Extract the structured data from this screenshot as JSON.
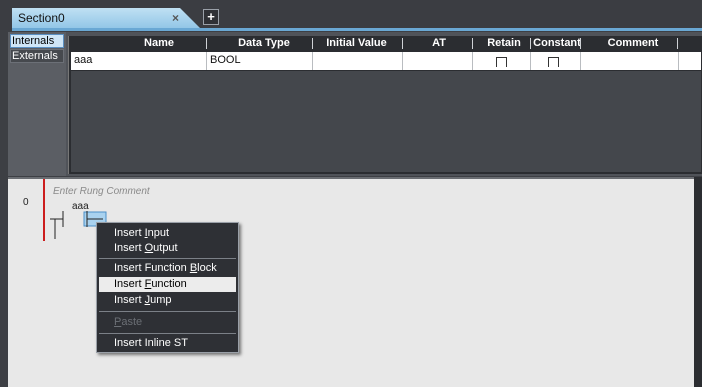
{
  "tab": {
    "title": "Section0",
    "close": "×",
    "add": "+"
  },
  "var_tabs": {
    "internals": "Internals",
    "externals": "Externals"
  },
  "table": {
    "headers": [
      "Name",
      "Data Type",
      "Initial Value",
      "AT",
      "Retain",
      "Constant",
      "Comment"
    ],
    "rows": [
      {
        "name": "aaa",
        "data_type": "BOOL",
        "initial_value": "",
        "at": "",
        "retain": false,
        "constant": false,
        "comment": ""
      }
    ]
  },
  "ladder": {
    "rung_number": "0",
    "rung_comment_placeholder": "Enter Rung Comment",
    "contact_variable": "aaa",
    "rail_color": "#cc1d1d"
  },
  "context_menu": {
    "items": [
      {
        "label": "Insert Input",
        "accel": "I",
        "state": "normal"
      },
      {
        "label": "Insert Output",
        "accel": "O",
        "state": "normal"
      },
      {
        "label": "Insert Function Block",
        "accel": "B",
        "state": "normal"
      },
      {
        "label": "Insert Function",
        "accel": "F",
        "state": "highlighted"
      },
      {
        "label": "Insert Jump",
        "accel": "J",
        "state": "normal"
      },
      {
        "label": "Paste",
        "accel": "P",
        "state": "disabled"
      },
      {
        "label": "Insert Inline ST",
        "accel": "",
        "state": "normal"
      }
    ]
  },
  "colors": {
    "background": "#3d3f44",
    "tab_active": "#8fc4e6",
    "menu_bg": "#2e3035",
    "menu_highlight": "#ececec"
  }
}
